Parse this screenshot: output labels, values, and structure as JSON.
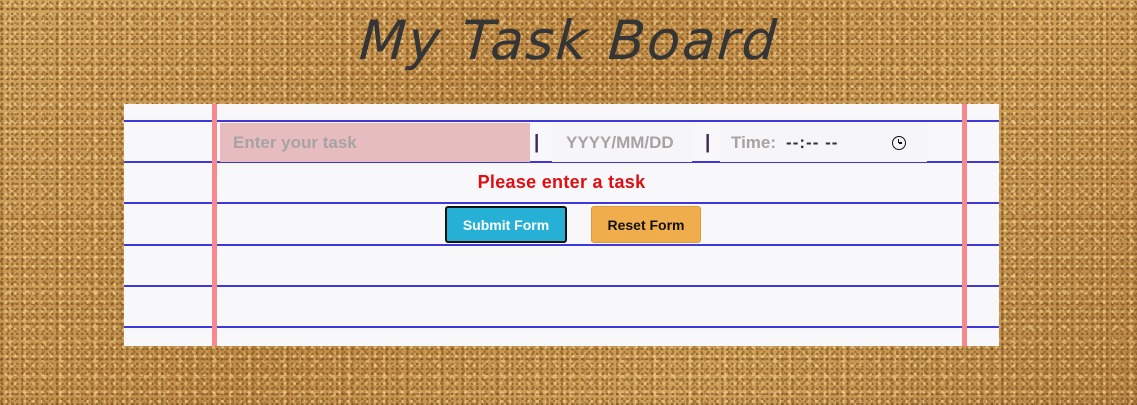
{
  "header": {
    "title": "My Task Board"
  },
  "form": {
    "task_placeholder": "Enter your task",
    "separator": "|",
    "date_placeholder": "YYYY/MM/DD",
    "time_label": "Time:",
    "time_value": "--:-- --",
    "error_message": "Please enter a task",
    "submit_label": "Submit Form",
    "reset_label": "Reset Form"
  },
  "colors": {
    "error": "#e00d12",
    "submit": "#27b0d6",
    "reset": "#efad4c",
    "rule_line": "#3f37d8",
    "margin_line": "#f48a8e",
    "task_field": "#e6bcbf"
  },
  "icons": {
    "time_picker": "clock-icon"
  }
}
